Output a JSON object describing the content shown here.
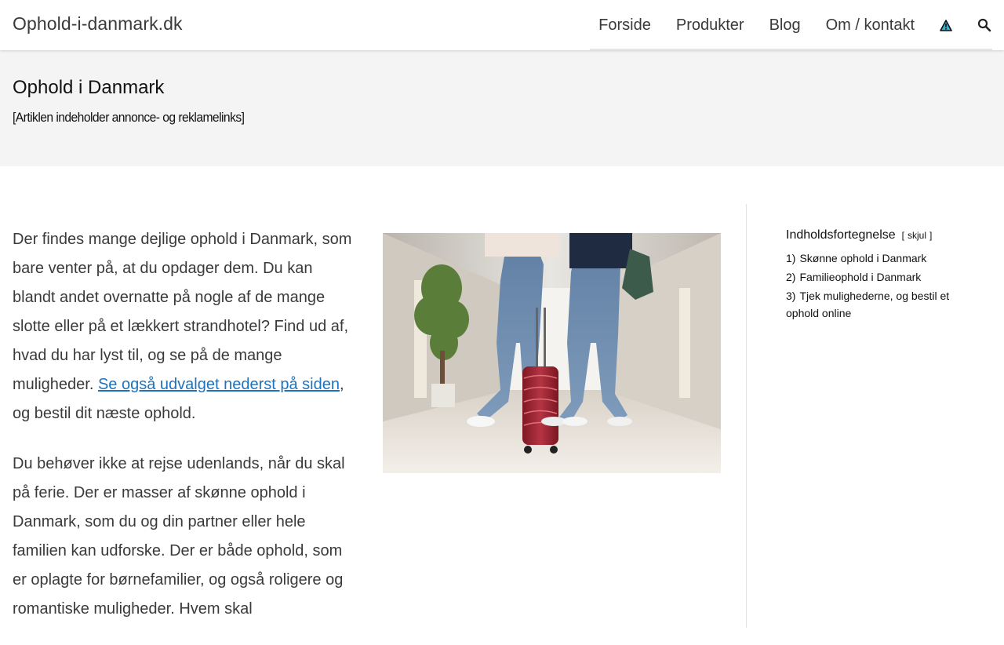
{
  "header": {
    "site_title": "Ophold-i-danmark.dk",
    "nav": [
      {
        "label": "Forside"
      },
      {
        "label": "Produkter"
      },
      {
        "label": "Blog"
      },
      {
        "label": "Om / kontakt"
      }
    ],
    "icons": [
      "warning-triangle-icon",
      "search-icon"
    ],
    "accent_color": "#1e73be"
  },
  "hero": {
    "title": "Ophold i Danmark",
    "note": "[Artiklen indeholder annonce- og reklamelinks]"
  },
  "article": {
    "para1_text": "Der findes mange dejlige ophold i Danmark, som bare venter på, at du opdager dem. Du kan blandt andet overnatte på nogle af de mange slotte eller på et lækkert strandhotel? Find ud af, hvad du har lyst til, og se på de mange muligheder.",
    "para1_link": "Se også udvalget nederst på siden",
    "para1_after": ", og bestil dit næste ophold.",
    "para2_text": "Du behøver ikke at rejse udenlands, når du skal på ferie. Der er masser af skønne ophold i Danmark, som du og din partner eller hele familien kan udforske. Der er både ophold, som er oplagte for børnefamilier, og også roligere og romantiske muligheder. Hvem skal"
  },
  "toc": {
    "title": "Indholdsfortegnelse",
    "toggle_open": "[",
    "toggle_label": "skjul",
    "toggle_close": "]",
    "items": [
      {
        "num": "1)",
        "label": "Skønne ophold i Danmark"
      },
      {
        "num": "2)",
        "label": "Familieophold i Danmark"
      },
      {
        "num": "3)",
        "label": "Tjek mulighederne, og bestil et ophold online"
      }
    ]
  }
}
